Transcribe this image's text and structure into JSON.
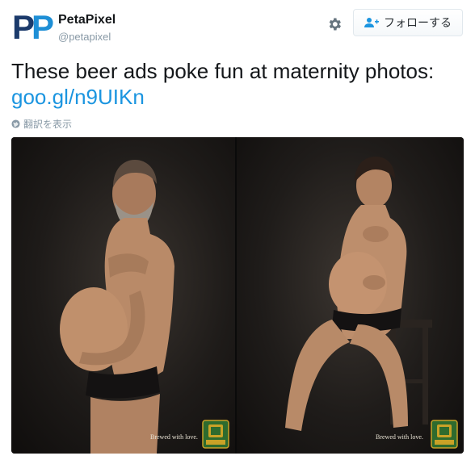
{
  "account": {
    "avatar_text": [
      "P",
      "P"
    ],
    "name": "PetaPixel",
    "handle": "@petapixel"
  },
  "actions": {
    "settings_icon": "gear-icon",
    "follow_label": "フォローする",
    "follow_icon": "add-user-icon"
  },
  "tweet": {
    "text": "These beer ads poke fun at maternity photos:",
    "link": "goo.gl/n9UIKn",
    "translate_label": "翻訳を表示",
    "translate_icon": "globe-icon"
  },
  "media": {
    "photos": [
      {
        "caption": "Brewed with love."
      },
      {
        "caption": "Brewed with love."
      }
    ]
  },
  "colors": {
    "text": "#14171a",
    "secondary": "#8899a6",
    "link": "#1b95e0",
    "brand_dark": "#1b3a6b",
    "brand_light": "#1e8fd6",
    "logo_green": "#2e6b2e",
    "logo_gold": "#c9a227"
  }
}
